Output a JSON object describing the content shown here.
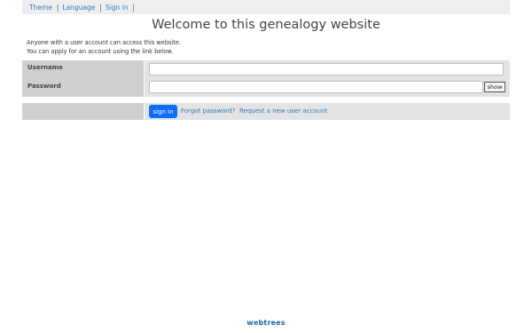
{
  "topbar": {
    "items": [
      {
        "label": "Theme"
      },
      {
        "label": "Language"
      },
      {
        "label": "Sign in"
      }
    ],
    "separator": "|"
  },
  "header": {
    "title": "Welcome to this genealogy website"
  },
  "intro": {
    "line1": "Anyone with a user account can access this website.",
    "line2": "You can apply for an account using the link below."
  },
  "login_form": {
    "username_label": "Username",
    "username_value": "",
    "password_label": "Password",
    "password_value": "",
    "show_label": "show"
  },
  "actions": {
    "sign_in_label": "sign in",
    "forgot_password_label": "Forgot password?",
    "request_account_label": "Request a new user account"
  },
  "footer": {
    "logo_text": "webtrees"
  },
  "colors": {
    "link": "#337ab7",
    "primary_button": "#0d6efd",
    "label_cell": "#cfcfcf",
    "value_cell": "#e3e3e3",
    "topbar": "#eeeeee"
  }
}
